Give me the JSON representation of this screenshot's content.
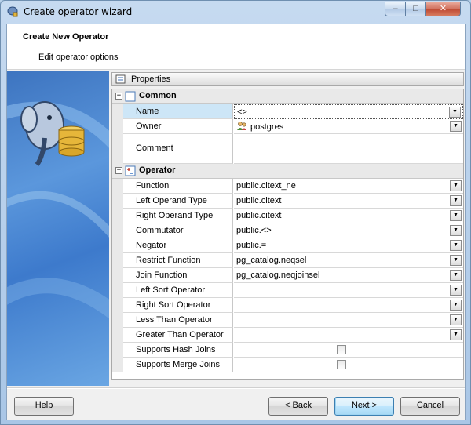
{
  "window": {
    "title": "Create operator wizard",
    "controls": {
      "minimize": "–",
      "maximize": "□",
      "close": "✕"
    }
  },
  "header": {
    "title": "Create New Operator",
    "subtitle": "Edit operator options"
  },
  "properties": {
    "label": "Properties",
    "categories": [
      {
        "name": "Common",
        "expander": "−",
        "items": [
          {
            "name": "Name",
            "value": "<>",
            "dropdown": true,
            "selected": true
          },
          {
            "name": "Owner",
            "value": "postgres",
            "dropdown": true,
            "icon": "user-group-icon"
          },
          {
            "name": "Comment",
            "value": "",
            "dropdown": false
          }
        ]
      },
      {
        "name": "Operator",
        "expander": "−",
        "items": [
          {
            "name": "Function",
            "value": "public.citext_ne",
            "dropdown": true
          },
          {
            "name": "Left Operand Type",
            "value": "public.citext",
            "dropdown": true
          },
          {
            "name": "Right Operand Type",
            "value": "public.citext",
            "dropdown": true
          },
          {
            "name": "Commutator",
            "value": "public.<>",
            "dropdown": true
          },
          {
            "name": "Negator",
            "value": "public.=",
            "dropdown": true
          },
          {
            "name": "Restrict Function",
            "value": "pg_catalog.neqsel",
            "dropdown": true
          },
          {
            "name": "Join Function",
            "value": "pg_catalog.neqjoinsel",
            "dropdown": true
          },
          {
            "name": "Left Sort Operator",
            "value": "",
            "dropdown": true
          },
          {
            "name": "Right Sort Operator",
            "value": "",
            "dropdown": true
          },
          {
            "name": "Less Than Operator",
            "value": "",
            "dropdown": true
          },
          {
            "name": "Greater Than Operator",
            "value": "",
            "dropdown": true
          },
          {
            "name": "Supports Hash Joins",
            "value": "",
            "checkbox": true,
            "checked": false
          },
          {
            "name": "Supports Merge Joins",
            "value": "",
            "checkbox": true,
            "checked": false
          }
        ]
      }
    ]
  },
  "buttons": {
    "help": "Help",
    "back": "< Back",
    "next": "Next >",
    "cancel": "Cancel"
  },
  "colors": {
    "selection": "#cde6f7",
    "category_bg": "#e9e9e9",
    "side_image": "#3d74c0"
  },
  "icons": {
    "app": "elephant-database-icon",
    "properties": "properties-icon",
    "dropdown": "chevron-down-icon"
  }
}
